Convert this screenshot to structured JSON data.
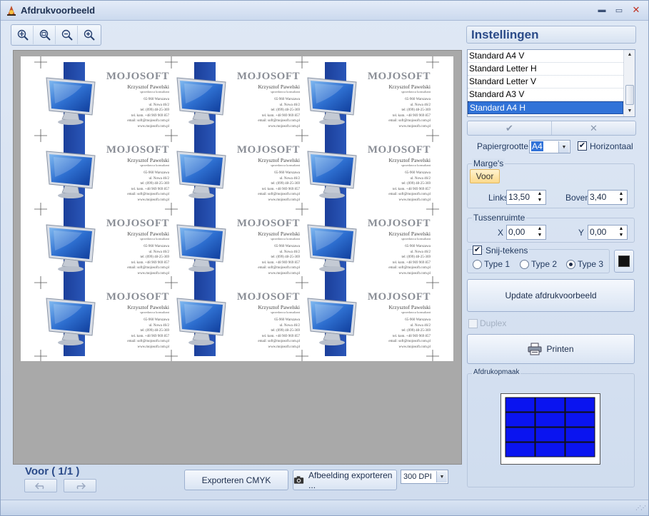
{
  "window": {
    "title": "Afdrukvoorbeeld",
    "icon": "app-icon",
    "controls": [
      "minimize-icon",
      "maximize-icon",
      "close-icon"
    ]
  },
  "toolbar": {
    "tools": [
      {
        "name": "zoom-fit-icon"
      },
      {
        "name": "zoom-page-icon"
      },
      {
        "name": "zoom-out-icon"
      },
      {
        "name": "zoom-in-icon"
      }
    ]
  },
  "preview": {
    "card": {
      "brand": "MOJOSOFT",
      "name": "Krzysztof Pawelski",
      "role": "sprzedawca konsultant",
      "lines": [
        "65-960 Warszawa",
        "ul. Nowa 46/2",
        "tel: (099) 48-25-369",
        "tel. kom. +48 969 969 857",
        "email: soft@mojosoft.com.pl",
        "www.mojosoft.com.pl"
      ]
    },
    "grid": {
      "rows": 4,
      "cols": 3
    }
  },
  "footer": {
    "page_label": "Voor ( 1/1 )",
    "export_cmyk": "Exporteren CMYK",
    "export_image": "Afbeelding exporteren ...",
    "dpi": "300 DPI"
  },
  "settings": {
    "title": "Instellingen",
    "paper_list": [
      "Standard A4 V",
      "Standard Letter H",
      "Standard Letter V",
      "Standard A3 V",
      "Standard A4 H"
    ],
    "selected_paper": "Standard A4 H",
    "paper_size_label": "Papiergrootte",
    "paper_size_value": "A4",
    "horizontal_label": "Horizontaal",
    "horizontal_checked": true,
    "margins_group": "Marge's",
    "margins_tab": "Voor",
    "left_label": "Links",
    "left_value": "13,50",
    "top_label": "Boven",
    "top_value": "3,40",
    "spacing_group": "Tussenruimte",
    "x_label": "X",
    "x_value": "0,00",
    "y_label": "Y",
    "y_value": "0,00",
    "cutmarks_label": "Snij-tekens",
    "cutmarks_checked": true,
    "type1_label": "Type 1",
    "type2_label": "Type 2",
    "type3_label": "Type 3",
    "selected_type": "Type 3",
    "update_label": "Update afdrukvoorbeeld",
    "duplex_label": "Duplex",
    "print_label": "Printen",
    "layout_group": "Afdrukopmaak",
    "layout_fill": "#0a14f0"
  }
}
